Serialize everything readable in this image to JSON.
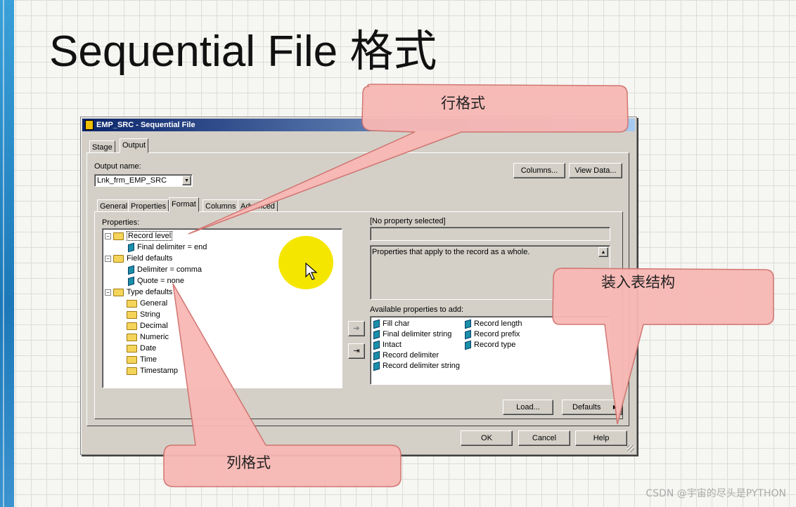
{
  "slide": {
    "title": "Sequential File 格式",
    "watermark": "CSDN @宇宙的尽头是PYTHON"
  },
  "dialog": {
    "title": "EMP_SRC - Sequential File",
    "top_tabs": [
      "Stage",
      "Output"
    ],
    "output_name_label": "Output name:",
    "output_name_value": "Lnk_frm_EMP_SRC",
    "columns_button": "Columns...",
    "view_data_button": "View Data...",
    "sub_tabs": [
      "General",
      "Properties",
      "Format",
      "Columns",
      "Advanced"
    ],
    "properties_label": "Properties:",
    "tree": {
      "record_level": "Record level",
      "final_delimiter": "Final delimiter = end",
      "field_defaults": "Field defaults",
      "delimiter": "Delimiter = comma",
      "quote": "Quote = none",
      "type_defaults": "Type defaults",
      "types": [
        "General",
        "String",
        "Decimal",
        "Numeric",
        "Date",
        "Time",
        "Timestamp"
      ]
    },
    "no_property_selected": "[No property selected]",
    "description": "Properties that apply to the record as a whole.",
    "available_label": "Available properties to add:",
    "available_col1": [
      "Fill char",
      "Final delimiter string",
      "Intact",
      "Record delimiter",
      "Record delimiter string"
    ],
    "available_col2": [
      "Record length",
      "Record prefix",
      "Record type"
    ],
    "load_button": "Load...",
    "defaults_button": "Defaults",
    "ok_button": "OK",
    "cancel_button": "Cancel",
    "help_button": "Help"
  },
  "callouts": {
    "row_format": "行格式",
    "column_format": "列格式",
    "load_table": "装入表结构"
  },
  "colors": {
    "callout_fill": "#f8b8b4",
    "callout_stroke": "#d0706c",
    "highlight": "#f5e600"
  }
}
